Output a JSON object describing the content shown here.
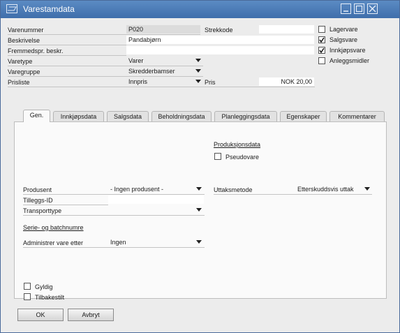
{
  "window": {
    "title": "Varestamdata",
    "app_icon": "window-icon",
    "buttons": [
      "minimize-icon",
      "maximize-icon",
      "close-icon"
    ]
  },
  "header": {
    "varenummer": {
      "label": "Varenummer",
      "value": "P020"
    },
    "strekkode": {
      "label": "Strekkode",
      "value": ""
    },
    "beskrivelse": {
      "label": "Beskrivelse",
      "value": "Pandabjørn"
    },
    "fremmedspr": {
      "label": "Fremmedspr. beskr.",
      "value": ""
    },
    "varetype": {
      "label": "Varetype",
      "value": "Varer"
    },
    "varegruppe": {
      "label": "Varegruppe",
      "value": "Skredderbamser"
    },
    "prisliste": {
      "label": "Prisliste",
      "value": "Innpris"
    },
    "pris": {
      "label": "Pris",
      "value": "NOK 20,00"
    }
  },
  "flags": [
    {
      "label": "Lagervare",
      "checked": false
    },
    {
      "label": "Salgsvare",
      "checked": true
    },
    {
      "label": "Innkjøpsvare",
      "checked": true
    },
    {
      "label": "Anleggsmidler",
      "checked": false
    }
  ],
  "tabs": [
    "Gen.",
    "Innkjøpsdata",
    "Salgsdata",
    "Beholdningsdata",
    "Planleggingsdata",
    "Egenskaper",
    "Kommentarer"
  ],
  "general": {
    "produksjonsdata": "Produksjonsdata",
    "pseudovare": {
      "label": "Pseudovare",
      "checked": false
    },
    "produsent": {
      "label": "Produsent",
      "value": "- Ingen produsent -"
    },
    "tilleggs_id": {
      "label": "Tilleggs-ID",
      "value": ""
    },
    "transporttype": {
      "label": "Transporttype",
      "value": ""
    },
    "uttaksmetode": {
      "label": "Uttaksmetode",
      "value": "Etterskuddsvis uttak"
    },
    "serie_batch": "Serie- og batchnumre",
    "administrer": {
      "label": "Administrer vare etter",
      "value": "Ingen"
    },
    "gyldig": {
      "label": "Gyldig",
      "checked": false
    },
    "tilbakestilt": {
      "label": "Tilbakestilt",
      "checked": false
    }
  },
  "footer": {
    "ok": "OK",
    "avbryt": "Avbryt"
  }
}
